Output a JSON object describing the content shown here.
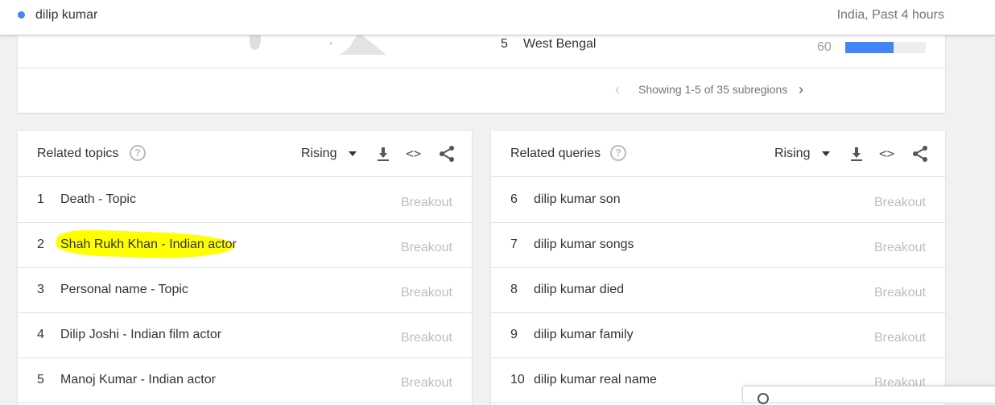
{
  "topbar": {
    "search_term": "dilip kumar",
    "meta": "India, Past 4 hours",
    "dot_color": "#4285f4"
  },
  "subregion": {
    "visible_row": {
      "rank": "5",
      "name": "West Bengal",
      "value": "60",
      "fill_percent": 60
    },
    "pager_text": "Showing 1-5 of 35 subregions",
    "prev_icon": "chevron-left-icon",
    "next_icon": "chevron-right-icon"
  },
  "related_topics": {
    "title": "Related topics",
    "sort": "Rising",
    "icons": [
      "help-icon",
      "download-icon",
      "embed-icon",
      "share-icon"
    ],
    "rows": [
      {
        "rank": "1",
        "label": "Death - Topic",
        "value": "Breakout"
      },
      {
        "rank": "2",
        "label": "Shah Rukh Khan - Indian actor",
        "value": "Breakout",
        "highlighted": true
      },
      {
        "rank": "3",
        "label": "Personal name - Topic",
        "value": "Breakout"
      },
      {
        "rank": "4",
        "label": "Dilip Joshi - Indian film actor",
        "value": "Breakout"
      },
      {
        "rank": "5",
        "label": "Manoj Kumar - Indian actor",
        "value": "Breakout"
      }
    ]
  },
  "related_queries": {
    "title": "Related queries",
    "sort": "Rising",
    "icons": [
      "help-icon",
      "download-icon",
      "embed-icon",
      "share-icon"
    ],
    "rows": [
      {
        "rank": "6",
        "label": "dilip kumar son",
        "value": "Breakout"
      },
      {
        "rank": "7",
        "label": "dilip kumar songs",
        "value": "Breakout"
      },
      {
        "rank": "8",
        "label": "dilip kumar died",
        "value": "Breakout"
      },
      {
        "rank": "9",
        "label": "dilip kumar family",
        "value": "Breakout"
      },
      {
        "rank": "10",
        "label": "dilip kumar real name",
        "value": "Breakout"
      }
    ]
  },
  "colors": {
    "accent": "#4285f4",
    "highlight": "#ffff00",
    "breakout_text": "#bdbdbd"
  }
}
